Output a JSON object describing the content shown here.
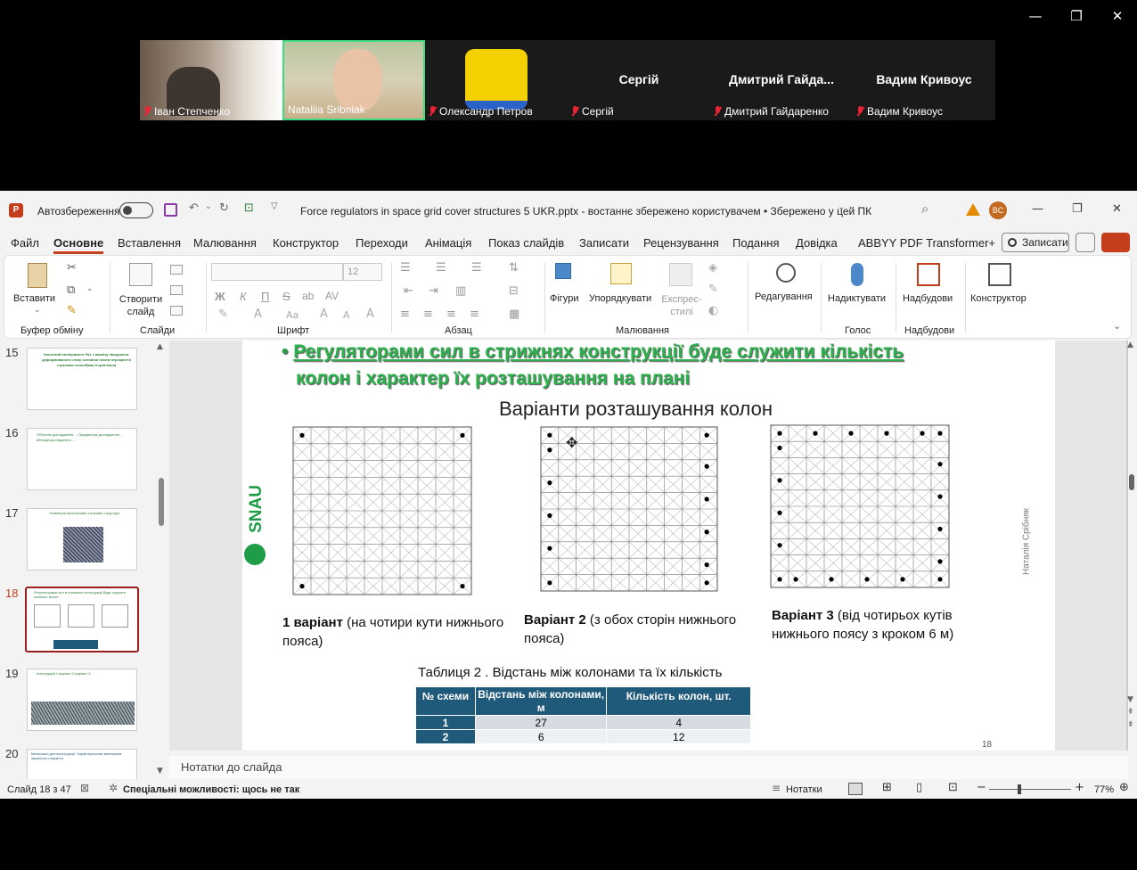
{
  "window_controls": {
    "minimize": "—",
    "restore": "❐",
    "close": "✕"
  },
  "participants": [
    {
      "name": "Іван Степченко",
      "muted": true
    },
    {
      "name": "Nataliia Sribniak",
      "muted": false,
      "active": true
    },
    {
      "name": "Олександр Петров",
      "muted": true
    },
    {
      "name": "Сергій",
      "muted": true,
      "display": "Сергій"
    },
    {
      "name": "Дмитрий Гайдаренко",
      "muted": true,
      "display": "Дмитрий  Гайда..."
    },
    {
      "name": "Вадим Кривоус",
      "muted": true,
      "display": "Вадим Кривоус"
    }
  ],
  "ppt": {
    "autosave_label": "Автозбереження",
    "doc_title": "Force regulators in space grid cover structures 5 UKR.pptx  -  востаннє збережено користувачем  •  Збережено у цей ПК",
    "user_initials": "BC",
    "menu": [
      "Файл",
      "Основне",
      "Вставлення",
      "Малювання",
      "Конструктор",
      "Переходи",
      "Анімація",
      "Показ слайдів",
      "Записати",
      "Рецензування",
      "Подання",
      "Довідка",
      "ABBYY PDF Transformer+"
    ],
    "active_menu": "Основне",
    "record_btn": "Записати",
    "ribbon": {
      "paste": "Вставити",
      "new_slide": "Створити слайд",
      "font_size": "12",
      "shapes": "Фігури",
      "arrange": "Упорядкувати",
      "quick_styles": "Експрес-стилі",
      "editing": "Редагування",
      "dictate": "Надиктувати",
      "addins": "Надбудови",
      "designer": "Конструктор",
      "groups": {
        "clipboard": "Буфер обміну",
        "slides": "Слайди",
        "font": "Шрифт",
        "paragraph": "Абзац",
        "drawing": "Малювання",
        "voice": "Голос",
        "addins": "Надбудови"
      },
      "font_btns": [
        "Ж",
        "К",
        "П",
        "S",
        "ab",
        "AV"
      ]
    },
    "thumbnails": [
      {
        "num": "15",
        "text": "Числений експеримент №1 з аналізу напружено-деформованого стану основної плити перекриття з різними способами її кріплення"
      },
      {
        "num": "16",
        "text": "Об'єктом дослідження ... Предметом дослідження ... Методи дослідження ..."
      },
      {
        "num": "17",
        "text": "Геометрія просторової стільової структури"
      },
      {
        "num": "18",
        "text": "Регуляторами сил в стрижнях конструкції буде служити кількість колон",
        "active": true
      },
      {
        "num": "19",
        "text": "Конструкції 1 варіант 2 варіант 3"
      },
      {
        "num": "20",
        "text": "Матеріали для конструкції. Характеристики матеріалів захисного покриття"
      }
    ],
    "slide": {
      "bullet_heading_1": "Регуляторами сил в стрижнях конструкції буде служити кількість",
      "bullet_heading_2": "колон і характер їх розташування на плані",
      "title": "Варіанти розташування колон",
      "logo_text": "SNAU",
      "author_vertical": "Наталія Срібняк",
      "variant1_bold": "1 варіант",
      "variant1_rest": " (на чотири кути нижнього пояса)",
      "variant2_bold": "Варіант 2",
      "variant2_rest": " (з обох сторін нижнього пояса)",
      "variant3_bold": "Варіант 3",
      "variant3_rest": " (від чотирьох кутів нижнього поясу з кроком 6 м)",
      "table_caption": "Таблиця 2 . Відстань між колонами та їх кількість",
      "table_headers": [
        "№ схеми",
        "Відстань між колонами, м",
        "Кількість колон, шт."
      ],
      "table_rows": [
        [
          "1",
          "27",
          "4"
        ],
        [
          "2",
          "6",
          "12"
        ]
      ],
      "page_num": "18"
    },
    "notes_placeholder": "Нотатки до слайда",
    "status": {
      "slide_info": "Слайд 18 з 47",
      "accessibility": "Спеціальні можливості: щось не так",
      "notes": "Нотатки",
      "zoom": "77%"
    }
  }
}
